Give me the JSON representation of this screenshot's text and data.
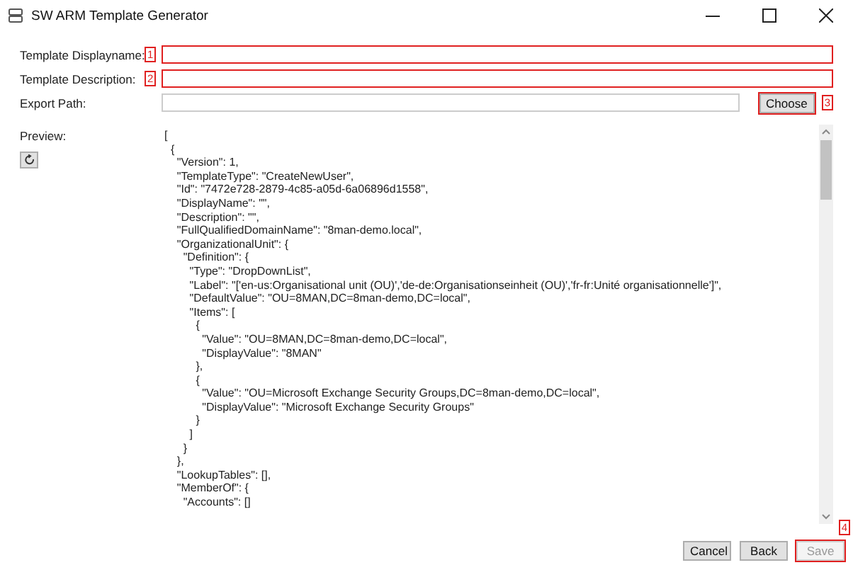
{
  "window": {
    "title": "SW ARM Template Generator"
  },
  "fields": [
    {
      "label": "Template Displayname:",
      "highlighted": true,
      "callout": "1"
    },
    {
      "label": "Template Description:",
      "highlighted": true,
      "callout": "2"
    },
    {
      "label": "Export Path:",
      "highlighted": false
    }
  ],
  "choose_button": {
    "label": "Choose",
    "highlighted": true,
    "callout": "3"
  },
  "preview": {
    "label": "Preview:",
    "lines": [
      "[",
      "  {",
      "    \"Version\": 1,",
      "    \"TemplateType\": \"CreateNewUser\",",
      "    \"Id\": \"7472e728-2879-4c85-a05d-6a06896d1558\",",
      "    \"DisplayName\": \"\",",
      "    \"Description\": \"\",",
      "    \"FullQualifiedDomainName\": \"8man-demo.local\",",
      "    \"OrganizationalUnit\": {",
      "      \"Definition\": {",
      "        \"Type\": \"DropDownList\",",
      "        \"Label\": \"['en-us:Organisational unit (OU)','de-de:Organisationseinheit (OU)','fr-fr:Unité organisationnelle']\",",
      "        \"DefaultValue\": \"OU=8MAN,DC=8man-demo,DC=local\",",
      "        \"Items\": [",
      "          {",
      "            \"Value\": \"OU=8MAN,DC=8man-demo,DC=local\",",
      "            \"DisplayValue\": \"8MAN\"",
      "          },",
      "          {",
      "            \"Value\": \"OU=Microsoft Exchange Security Groups,DC=8man-demo,DC=local\",",
      "            \"DisplayValue\": \"Microsoft Exchange Security Groups\"",
      "          }",
      "        ]",
      "      }",
      "    },",
      "    \"LookupTables\": [],",
      "    \"MemberOf\": {",
      "      \"Accounts\": []"
    ]
  },
  "buttons": [
    {
      "label": "Cancel",
      "disabled": false,
      "highlighted": false
    },
    {
      "label": "Back",
      "disabled": false,
      "highlighted": false
    },
    {
      "label": "Save",
      "disabled": true,
      "highlighted": true,
      "callout": "4"
    }
  ]
}
